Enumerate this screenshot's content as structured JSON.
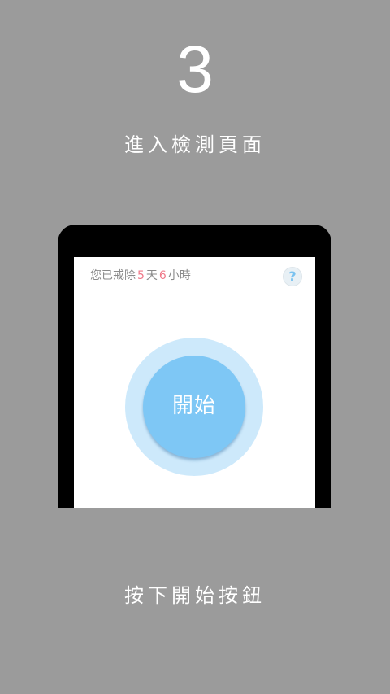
{
  "step": {
    "number": "3",
    "title": "進入檢測頁面",
    "caption": "按下開始按鈕"
  },
  "screen": {
    "status": {
      "prefix": "您已戒除",
      "days": "5",
      "days_unit": "天",
      "hours": "6",
      "hours_unit": "小時"
    },
    "help_label": "?",
    "start_label": "開始"
  },
  "colors": {
    "background": "#9b9b9b",
    "accent_blue": "#7ec7f5",
    "ring_blue": "#cde9fb",
    "highlight_pink": "#f07a8a"
  }
}
